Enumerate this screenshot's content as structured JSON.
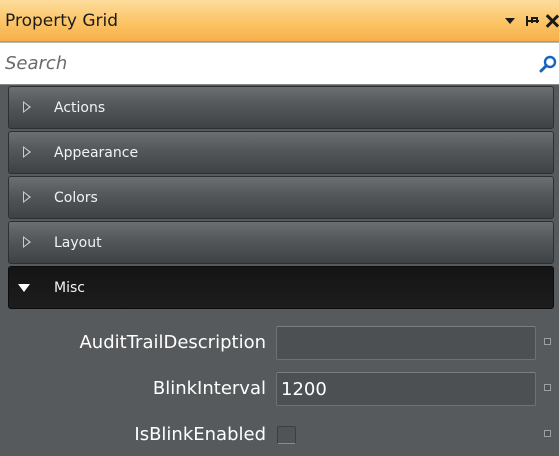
{
  "window": {
    "title": "Property Grid",
    "controls": {
      "dropdown_icon": "chevron-down-icon",
      "pin_icon": "pin-icon",
      "close_icon": "close-icon"
    },
    "accent_color": "#fbc465"
  },
  "search": {
    "placeholder": "Search",
    "value": "",
    "icon": "search-icon"
  },
  "categories": [
    {
      "label": "Actions",
      "expanded": false
    },
    {
      "label": "Appearance",
      "expanded": false
    },
    {
      "label": "Colors",
      "expanded": false
    },
    {
      "label": "Layout",
      "expanded": false
    },
    {
      "label": "Misc",
      "expanded": true
    }
  ],
  "properties": [
    {
      "name": "AuditTrailDescription",
      "type": "text",
      "value": ""
    },
    {
      "name": "BlinkInterval",
      "type": "text",
      "value": "1200"
    },
    {
      "name": "IsBlinkEnabled",
      "type": "checkbox",
      "checked": false
    }
  ]
}
